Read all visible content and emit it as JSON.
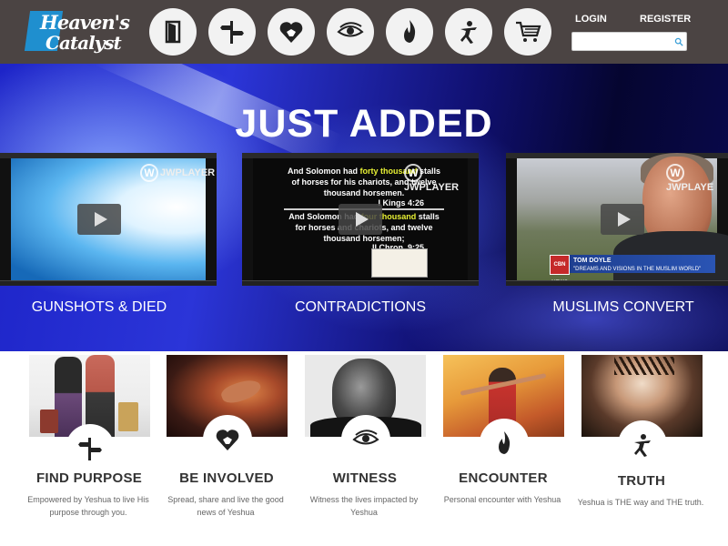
{
  "brand": {
    "line1": "Heaven's",
    "line2": "Catalyst",
    "accent": "#1f8fcf"
  },
  "header": {
    "nav_icons": [
      "door-icon",
      "signpost-icon",
      "heart-hand-icon",
      "eye-icon",
      "flame-icon",
      "figure-icon",
      "cart-icon"
    ],
    "login_label": "LOGIN",
    "register_label": "REGISTER",
    "search_placeholder": "",
    "search_icon": "search-icon"
  },
  "hero": {
    "title": "JUST ADDED",
    "videos": [
      {
        "caption": "GUNSHOTS & DIED",
        "player": "JWPLAYER"
      },
      {
        "caption": "CONTRADICTIONS",
        "player": "JWPLAYER",
        "verse1_a": "And Solomon had ",
        "verse1_hl": "forty thousand",
        "verse1_b": " stalls of horses for his chariots,",
        "verse1_c": " and twelve thousand horsemen.",
        "ref1": "I Kings 4:26",
        "verse2_a": "And Solomon had ",
        "verse2_hl": "four thousand",
        "verse2_b": " stalls for horses and chariots, and twelve thousand horsemen;",
        "ref2": "II Chron. 9:25"
      },
      {
        "caption": "MUSLIMS CONVERT",
        "player": "JWPLAYE",
        "news_logo": "CBN NEWS",
        "name": "TOM DOYLE",
        "quote": "\"DREAMS AND VISIONS IN THE MUSLIM WORLD\""
      }
    ]
  },
  "features": [
    {
      "title": "FIND PURPOSE",
      "desc": "Empowered by Yeshua to live His purpose through you.",
      "icon": "signpost-icon"
    },
    {
      "title": "BE INVOLVED",
      "desc": "Spread, share and live the good news of Yeshua",
      "icon": "heart-hand-icon"
    },
    {
      "title": "WITNESS",
      "desc": "Witness the lives impacted by Yeshua",
      "icon": "eye-icon"
    },
    {
      "title": "ENCOUNTER",
      "desc": "Personal encounter with Yeshua",
      "icon": "flame-icon"
    },
    {
      "title": "TRUTH",
      "desc": "Yeshua is THE way and THE truth.",
      "icon": "figure-icon"
    }
  ]
}
